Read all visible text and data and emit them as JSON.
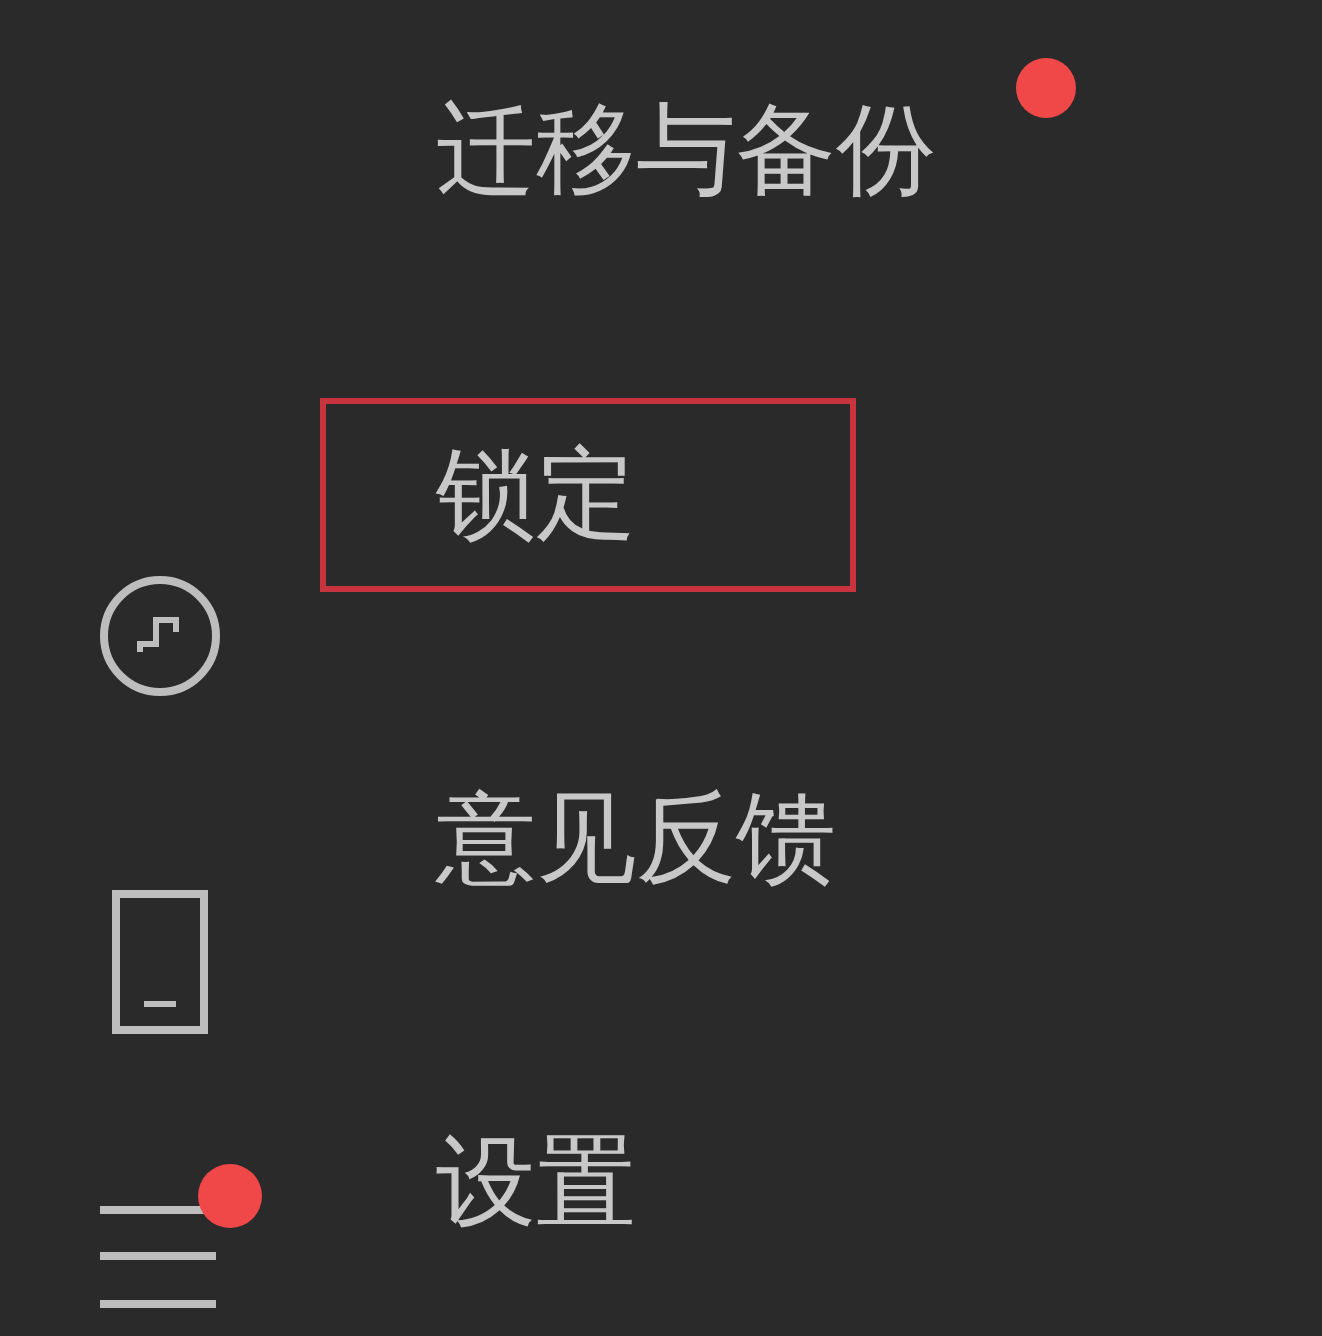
{
  "sidebar": [
    {
      "kind": "mini-program",
      "badge": false
    },
    {
      "kind": "phone",
      "badge": false
    },
    {
      "kind": "menu",
      "badge": true
    }
  ],
  "menu": {
    "items": [
      {
        "label": "迁移与备份",
        "selected": false,
        "badge": true
      },
      {
        "label": "锁定",
        "selected": true,
        "badge": false
      },
      {
        "label": "意见反馈",
        "selected": false,
        "badge": false
      },
      {
        "label": "设置",
        "selected": false,
        "badge": false
      }
    ]
  }
}
